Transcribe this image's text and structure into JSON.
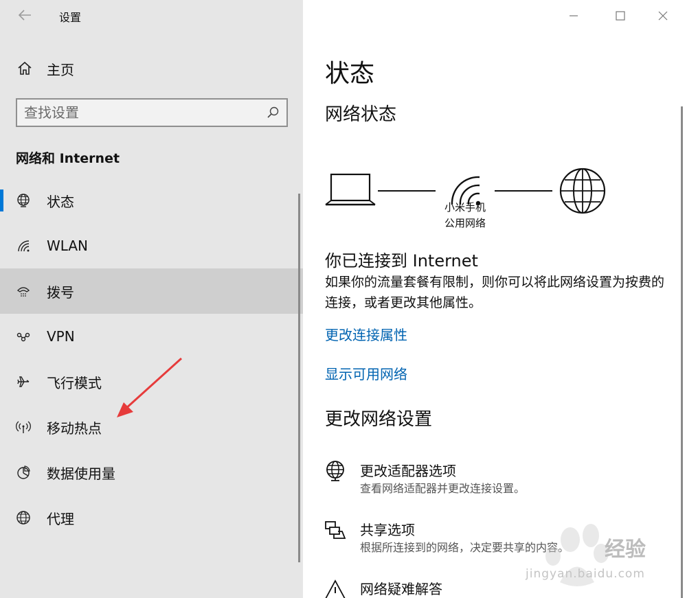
{
  "window": {
    "app_title": "设置"
  },
  "sidebar": {
    "home_label": "主页",
    "search_placeholder": "查找设置",
    "section_title": "网络和 Internet",
    "items": [
      {
        "label": "状态",
        "icon": "globe-status-icon",
        "selected": true
      },
      {
        "label": "WLAN",
        "icon": "wifi-icon"
      },
      {
        "label": "拨号",
        "icon": "dialup-icon",
        "hovered": true
      },
      {
        "label": "VPN",
        "icon": "vpn-icon"
      },
      {
        "label": "飞行模式",
        "icon": "airplane-icon"
      },
      {
        "label": "移动热点",
        "icon": "hotspot-icon"
      },
      {
        "label": "数据使用量",
        "icon": "data-usage-icon"
      },
      {
        "label": "代理",
        "icon": "globe-icon"
      }
    ]
  },
  "main": {
    "page_title": "状态",
    "network_status_heading": "网络状态",
    "network_name_line1": "小米手机",
    "network_name_line2": "公用网络",
    "connected_title": "你已连接到 Internet",
    "connected_desc": "如果你的流量套餐有限制，则你可以将此网络设置为按费的连接，或者更改其他属性。",
    "link_change_properties": "更改连接属性",
    "link_show_networks": "显示可用网络",
    "change_settings_heading": "更改网络设置",
    "options": [
      {
        "title": "更改适配器选项",
        "desc": "查看网络适配器并更改连接设置。",
        "icon": "adapter-icon"
      },
      {
        "title": "共享选项",
        "desc": "根据所连接到的网络，决定要共享的内容。",
        "icon": "sharing-icon"
      },
      {
        "title": "网络疑难解答",
        "desc": "",
        "icon": "warning-icon"
      }
    ]
  },
  "watermark": {
    "brand": "经验",
    "url": "jingyan.baidu.com"
  },
  "colors": {
    "accent": "#0078d7",
    "link": "#0063b1",
    "sidebar_bg": "#e6e6e6",
    "annotation_arrow": "#e63b3b"
  }
}
